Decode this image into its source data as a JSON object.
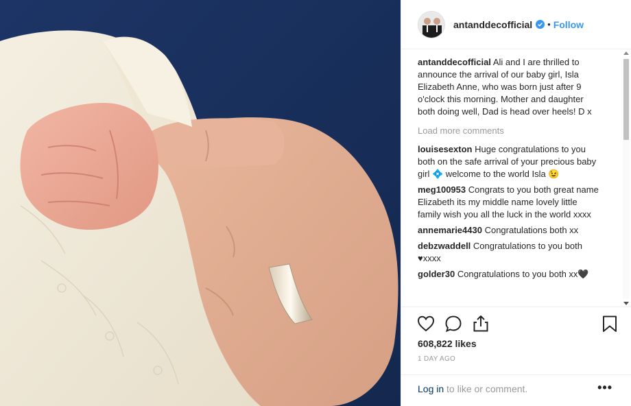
{
  "post": {
    "username": "antanddecofficial",
    "separator": "•",
    "follow_label": "Follow",
    "caption_user": "antanddecofficial",
    "caption_text": "Ali and I are thrilled to announce the arrival of our baby girl, Isla Elizabeth Anne, who was born just after 9 o'clock this morning. Mother and daughter both doing well, Dad is head over heels! D x",
    "load_more": "Load more comments",
    "comments": [
      {
        "user": "louisesexton",
        "text": "Huge congratulations to you both on the safe arrival of your precious baby girl 💠 welcome to the world Isla 😉"
      },
      {
        "user": "meg100953",
        "text": "Congrats to you both great name Elizabeth its my middle name lovely little family wish you all the luck in the world xxxx"
      },
      {
        "user": "annemarie4430",
        "text": "Congratulations both xx"
      },
      {
        "user": "debzwaddell",
        "text": "Congratulations to you both ♥xxxx"
      },
      {
        "user": "golder30",
        "text": "Congratulations to you both xx🖤"
      }
    ],
    "likes": "608,822 likes",
    "date": "1 DAY AGO",
    "login_link": "Log in",
    "login_rest": " to like or comment.",
    "more_label": "•••"
  },
  "icons": {
    "like": "heart-icon",
    "comment": "comment-icon",
    "share": "share-icon",
    "save": "bookmark-icon",
    "verified": "verified-badge-icon"
  },
  "colors": {
    "link_blue": "#3897f0",
    "text": "#262626",
    "muted": "#999999",
    "divider": "#efefef",
    "login_link": "#003569"
  }
}
